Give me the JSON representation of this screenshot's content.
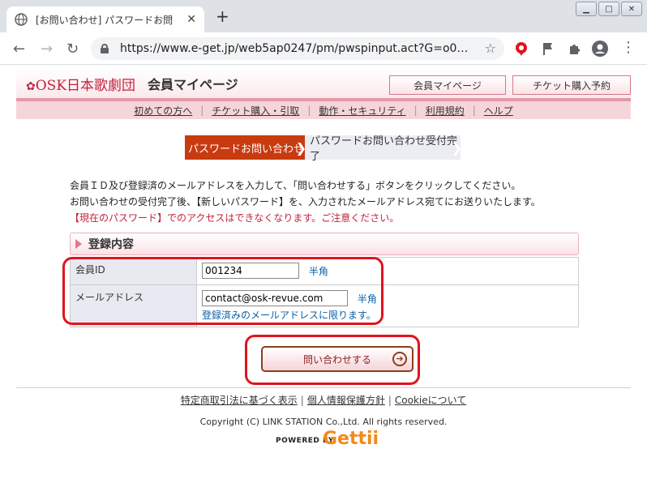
{
  "browser": {
    "tab_title": "[お問い合わせ] パスワードお問",
    "url": "https://www.e-get.jp/web5ap0247/pm/pwspinput.act?G=o0…"
  },
  "header": {
    "logo": "OSK日本歌劇団",
    "site_title": "会員マイページ",
    "buttons": [
      "会員マイページ",
      "チケット購入予約"
    ]
  },
  "subnav": [
    "初めての方へ",
    "チケット購入・引取",
    "動作・セキュリティ",
    "利用規約",
    "ヘルプ"
  ],
  "steps": {
    "current": "パスワードお問い合わせ",
    "next": "パスワードお問い合わせ受付完了"
  },
  "intro": {
    "line1": "会員ＩＤ及び登録済のメールアドレスを入力して、「問い合わせする」ボタンをクリックしてください。",
    "line2": "お問い合わせの受付完了後、【新しいパスワード】を、入力されたメールアドレス宛てにお送りいたします。",
    "warning": "【現在のパスワード】でのアクセスはできなくなります。ご注意ください。"
  },
  "form": {
    "section_title": "登録内容",
    "member_id_label": "会員ID",
    "member_id_value": "001234",
    "member_id_hint": "半角",
    "email_label": "メールアドレス",
    "email_value": "contact@osk-revue.com",
    "email_hint": "半角",
    "email_note": "登録済みのメールアドレスに限ります。",
    "submit_label": "問い合わせする"
  },
  "footer": {
    "links": [
      "特定商取引法に基づく表示",
      "個人情報保護方針",
      "Cookieについて"
    ],
    "copyright": "Copyright (C) LINK STATION Co.,Ltd. All rights reserved.",
    "powered_by": "POWERED BY",
    "brand": "Gettii"
  }
}
